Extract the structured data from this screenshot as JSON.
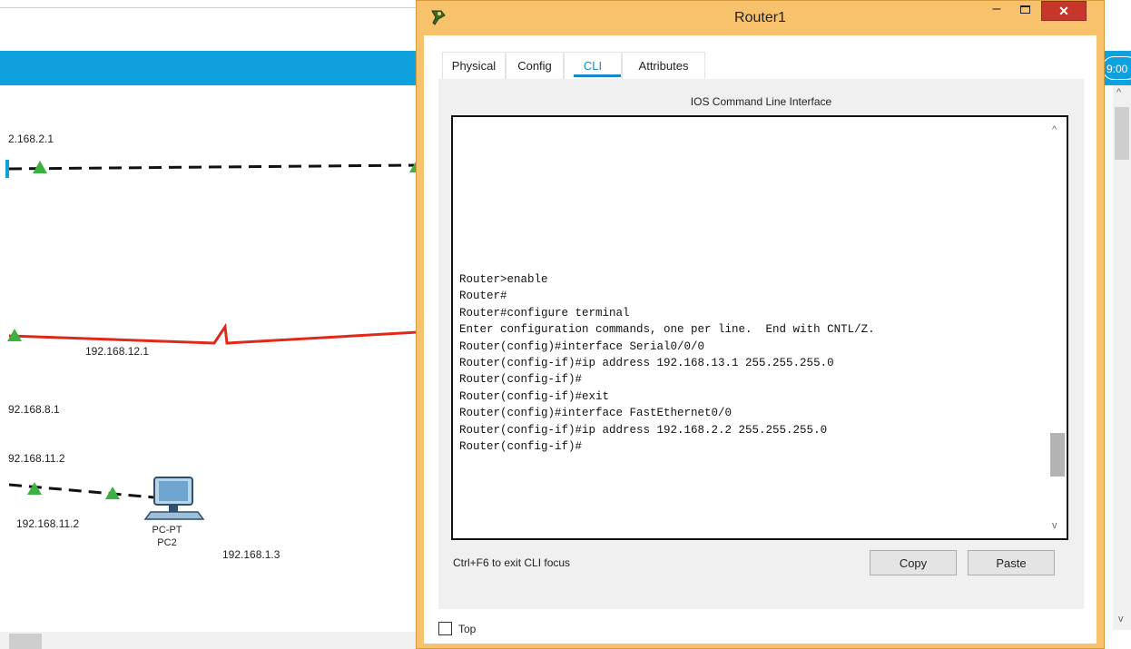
{
  "workspace": {
    "clock": "9:00",
    "ip_labels": [
      "2.168.2.1",
      "192.168.12.1",
      "92.168.8.1",
      "92.168.11.2",
      "192.168.11.2",
      "192.168.1.3"
    ],
    "devices": [
      {
        "type": "PC-PT",
        "name": "PC2"
      }
    ],
    "colors": {
      "toolbar": "#0fa0de",
      "serial_link": "#e0291b",
      "link_up": "#3cb043"
    }
  },
  "router_window": {
    "title": "Router1",
    "controls": {
      "minimize": "–",
      "close": "✕"
    },
    "tabs": [
      {
        "label": "Physical",
        "active": false
      },
      {
        "label": "Config",
        "active": false
      },
      {
        "label": "CLI",
        "active": true
      },
      {
        "label": "Attributes",
        "active": false
      }
    ],
    "panel_title": "IOS Command Line Interface",
    "cli_lines": [
      "Router>enable",
      "Router#",
      "Router#configure terminal",
      "Enter configuration commands, one per line.  End with CNTL/Z.",
      "Router(config)#interface Serial0/0/0",
      "Router(config-if)#ip address 192.168.13.1 255.255.255.0",
      "Router(config-if)#",
      "Router(config-if)#exit",
      "Router(config)#interface FastEthernet0/0",
      "Router(config-if)#ip address 192.168.2.2 255.255.255.0",
      "Router(config-if)#"
    ],
    "hint": "Ctrl+F6 to exit CLI focus",
    "copy_label": "Copy",
    "paste_label": "Paste",
    "top_checkbox_label": "Top",
    "top_checked": false,
    "accent_color": "#1a87c6",
    "frame_color": "#f7c26b"
  }
}
